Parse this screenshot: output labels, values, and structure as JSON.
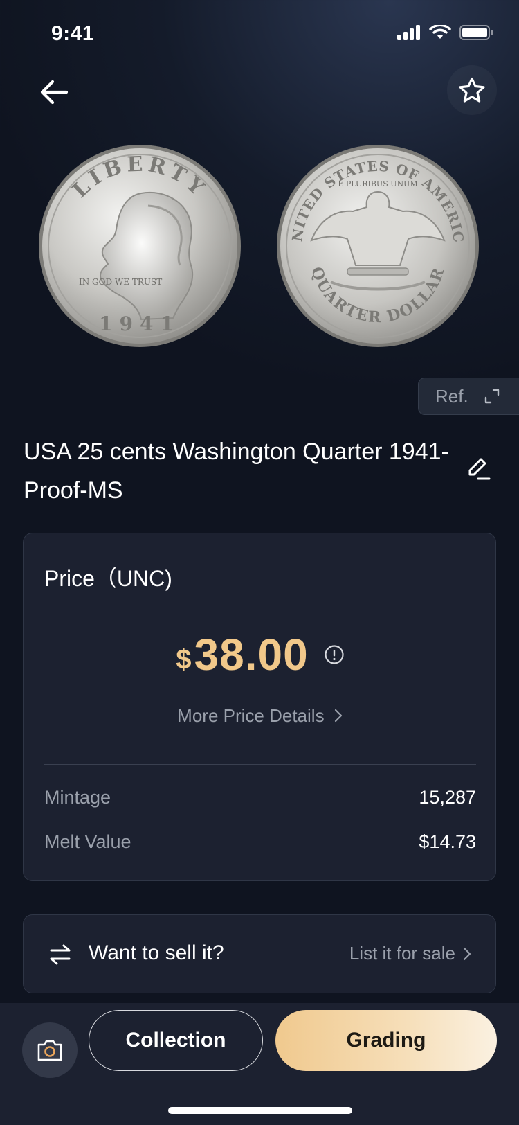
{
  "status_bar": {
    "time": "9:41"
  },
  "coin": {
    "title": "USA 25 cents  Washington Quarter 1941-Proof-MS",
    "front_text_top": "LIBERTY",
    "front_text_motto": "IN GOD WE TRUST",
    "front_text_year": "1941",
    "back_text_top": "UNITED STATES OF AMERICA",
    "back_text_motto": "E PLURIBUS UNUM",
    "back_text_bottom": "QUARTER DOLLAR"
  },
  "reference_button": {
    "label": "Ref."
  },
  "price_card": {
    "label": "Price（UNC)",
    "currency": "$",
    "value": "38.00",
    "more_details": "More Price Details",
    "stats": [
      {
        "label": "Mintage",
        "value": "15,287"
      },
      {
        "label": "Melt Value",
        "value": "$14.73"
      }
    ]
  },
  "sell_card": {
    "title": "Want to sell it?",
    "link": "List it for sale"
  },
  "bottom_bar": {
    "collection_label": "Collection",
    "grading_label": "Grading"
  },
  "icons": {
    "back": "arrow-left-icon",
    "favorite": "star-icon",
    "edit": "edit-icon",
    "expand": "expand-icon",
    "info": "info-icon",
    "chevron": "chevron-right-icon",
    "swap": "swap-icon",
    "camera": "camera-icon"
  },
  "colors": {
    "accent_gold": "#f1c88a",
    "background": "#141b2a",
    "card": "#1c2130"
  }
}
